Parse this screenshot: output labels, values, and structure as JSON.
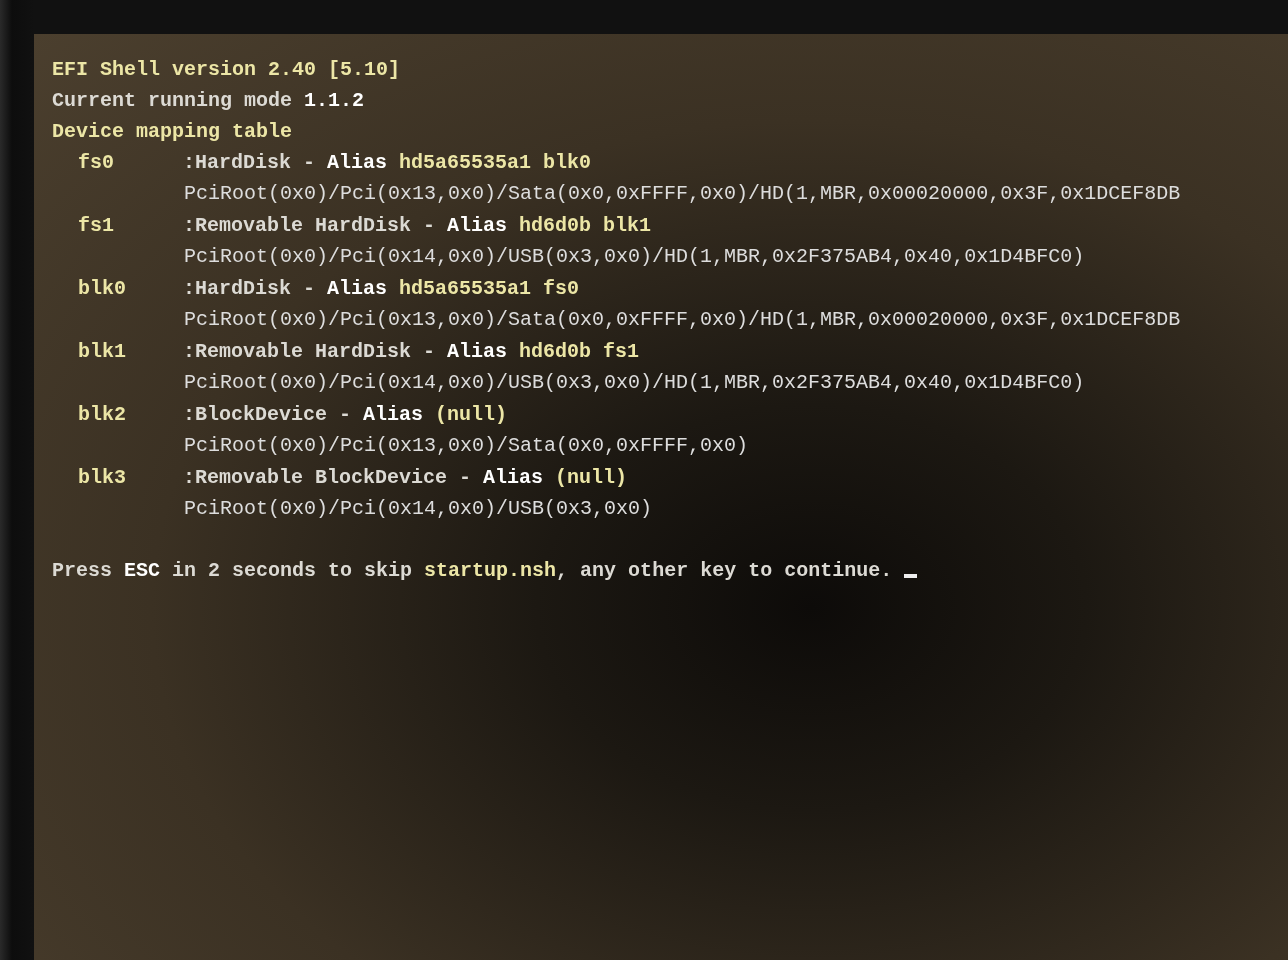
{
  "header_lines": [
    [
      {
        "text": "EFI Shell version 2.40 [5.10]",
        "kind": "highlight"
      }
    ],
    [
      {
        "text": "Current running mode ",
        "kind": "plain"
      },
      {
        "text": "1.1.2",
        "kind": "bold"
      }
    ],
    [
      {
        "text": "Device mapping table",
        "kind": "highlight"
      }
    ]
  ],
  "mappings": [
    {
      "name": "fs0",
      "description": [
        {
          "text": ":HardDisk - ",
          "kind": "plain"
        },
        {
          "text": "Alias",
          "kind": "bold"
        },
        {
          "text": " hd5a65535a1 blk0",
          "kind": "highlight"
        }
      ],
      "path": "PciRoot(0x0)/Pci(0x13,0x0)/Sata(0x0,0xFFFF,0x0)/HD(1,MBR,0x00020000,0x3F,0x1DCEF8DB"
    },
    {
      "name": "fs1",
      "description": [
        {
          "text": ":Removable HardDisk - ",
          "kind": "plain"
        },
        {
          "text": "Alias",
          "kind": "bold"
        },
        {
          "text": " hd6d0b blk1",
          "kind": "highlight"
        }
      ],
      "path": "PciRoot(0x0)/Pci(0x14,0x0)/USB(0x3,0x0)/HD(1,MBR,0x2F375AB4,0x40,0x1D4BFC0)"
    },
    {
      "name": "blk0",
      "description": [
        {
          "text": ":HardDisk - ",
          "kind": "plain"
        },
        {
          "text": "Alias",
          "kind": "bold"
        },
        {
          "text": " hd5a65535a1 fs0",
          "kind": "highlight"
        }
      ],
      "path": "PciRoot(0x0)/Pci(0x13,0x0)/Sata(0x0,0xFFFF,0x0)/HD(1,MBR,0x00020000,0x3F,0x1DCEF8DB"
    },
    {
      "name": "blk1",
      "description": [
        {
          "text": ":Removable HardDisk - ",
          "kind": "plain"
        },
        {
          "text": "Alias",
          "kind": "bold"
        },
        {
          "text": " hd6d0b fs1",
          "kind": "highlight"
        }
      ],
      "path": "PciRoot(0x0)/Pci(0x14,0x0)/USB(0x3,0x0)/HD(1,MBR,0x2F375AB4,0x40,0x1D4BFC0)"
    },
    {
      "name": "blk2",
      "description": [
        {
          "text": ":BlockDevice - ",
          "kind": "plain"
        },
        {
          "text": "Alias",
          "kind": "bold"
        },
        {
          "text": " (null)",
          "kind": "highlight"
        }
      ],
      "path": "PciRoot(0x0)/Pci(0x13,0x0)/Sata(0x0,0xFFFF,0x0)"
    },
    {
      "name": "blk3",
      "description": [
        {
          "text": ":Removable BlockDevice - ",
          "kind": "plain"
        },
        {
          "text": "Alias",
          "kind": "bold"
        },
        {
          "text": " (null)",
          "kind": "highlight"
        }
      ],
      "path": "PciRoot(0x0)/Pci(0x14,0x0)/USB(0x3,0x0)"
    }
  ],
  "prompt": [
    {
      "text": "Press ",
      "kind": "plain"
    },
    {
      "text": "ESC",
      "kind": "bold"
    },
    {
      "text": " in 2 seconds to skip ",
      "kind": "plain"
    },
    {
      "text": "startup.nsh",
      "kind": "highlight"
    },
    {
      "text": ", any other key to continue.",
      "kind": "plain"
    }
  ],
  "cursor": {
    "visible": true
  }
}
